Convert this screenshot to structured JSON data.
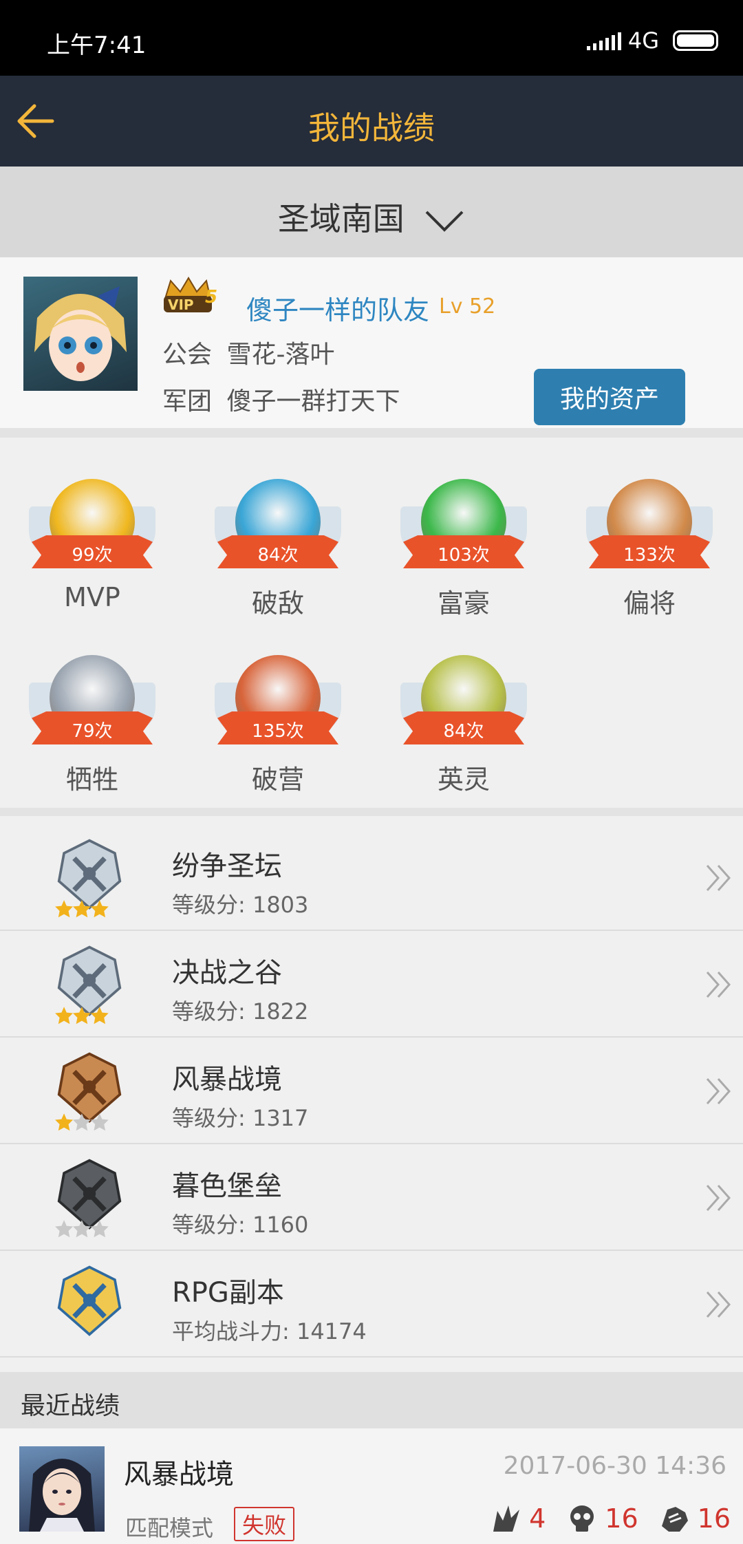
{
  "status_bar": {
    "time": "上午7:41",
    "network": "4G"
  },
  "header": {
    "title": "我的战绩"
  },
  "server": {
    "name": "圣域南国"
  },
  "profile": {
    "name": "傻子一样的队友",
    "level": "Lv 52",
    "vip": "VIP5",
    "guild_label": "公会",
    "guild": "雪花-落叶",
    "legion_label": "军团",
    "legion": "傻子一群打天下",
    "assets_button": "我的资产"
  },
  "badges": [
    {
      "label": "MVP",
      "count": "99次",
      "color": "#f0b820"
    },
    {
      "label": "破敌",
      "count": "84次",
      "color": "#3aa6d6"
    },
    {
      "label": "富豪",
      "count": "103次",
      "color": "#3cb84a"
    },
    {
      "label": "偏将",
      "count": "133次",
      "color": "#d28a4a"
    },
    {
      "label": "牺牲",
      "count": "79次",
      "color": "#9aa4b0"
    },
    {
      "label": "破营",
      "count": "135次",
      "color": "#d8643a"
    },
    {
      "label": "英灵",
      "count": "84次",
      "color": "#b7c04a"
    }
  ],
  "modes": [
    {
      "name": "纷争圣坛",
      "score_label": "等级分: 1803",
      "stars": 3,
      "tier": "silver"
    },
    {
      "name": "决战之谷",
      "score_label": "等级分: 1822",
      "stars": 3,
      "tier": "silver"
    },
    {
      "name": "风暴战境",
      "score_label": "等级分: 1317",
      "stars": 1,
      "tier": "bronze"
    },
    {
      "name": "暮色堡垒",
      "score_label": "等级分: 1160",
      "stars": 0,
      "tier": "iron"
    },
    {
      "name": "RPG副本",
      "score_label": "平均战斗力: 14174",
      "stars": -1,
      "tier": "gold"
    }
  ],
  "recent": {
    "heading": "最近战绩",
    "match": {
      "title": "风暴战境",
      "date": "2017-06-30 14:36",
      "mode": "匹配模式",
      "result": "失败",
      "kills": "4",
      "deaths": "16",
      "assists": "16"
    }
  },
  "colors": {
    "header_bg": "#252c3a",
    "accent": "#f3b63a",
    "name_blue": "#2e86c1",
    "button_blue": "#2e7fb0",
    "loss_red": "#d0352e"
  }
}
